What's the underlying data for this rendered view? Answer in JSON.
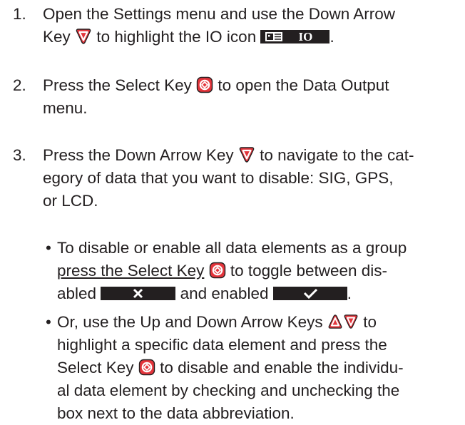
{
  "colors": {
    "text": "#231f20",
    "key_red": "#e4353c",
    "bar": "#231f20"
  },
  "steps": [
    {
      "number": "1.",
      "line1": "Open the Settings menu and use the Down Arrow",
      "line2_a": "Key",
      "line2_b": "to highlight the IO icon",
      "line2_c": ".",
      "io_label": "IO"
    },
    {
      "number": "2.",
      "line1_a": "Press the Select Key",
      "line1_b": "to open the Data Output",
      "line2": "menu."
    },
    {
      "number": "3.",
      "line1_a": "Press the Down Arrow Key",
      "line1_b": "to navigate to the cat-",
      "line2": "egory of data that you want to disable: SIG, GPS,",
      "line3": "or LCD."
    }
  ],
  "bullets": [
    {
      "dot": "•",
      "line1": "To disable or enable all data elements as a group",
      "line2_a": "press the Select Key",
      "line2_b": "to toggle between dis-",
      "line3_a": "abled",
      "line3_b": "and enabled",
      "line3_c": "."
    },
    {
      "dot": "•",
      "line1_a": "Or, use the Up and Down Arrow Keys",
      "line1_b": "to",
      "line2": "highlight a specific data element and press the",
      "line3_a": "Select Key",
      "line3_b": "to disable and enable the individu-",
      "line4": "al data element by checking and unchecking the",
      "line5": "box next to the data abbreviation."
    }
  ],
  "icons": {
    "down_arrow_key": "down-arrow-key-icon",
    "up_arrow_key": "up-arrow-key-icon",
    "select_key": "select-key-icon",
    "io_menu": "io-menu-icon",
    "disabled": "disabled-x-icon",
    "enabled": "enabled-check-icon"
  }
}
